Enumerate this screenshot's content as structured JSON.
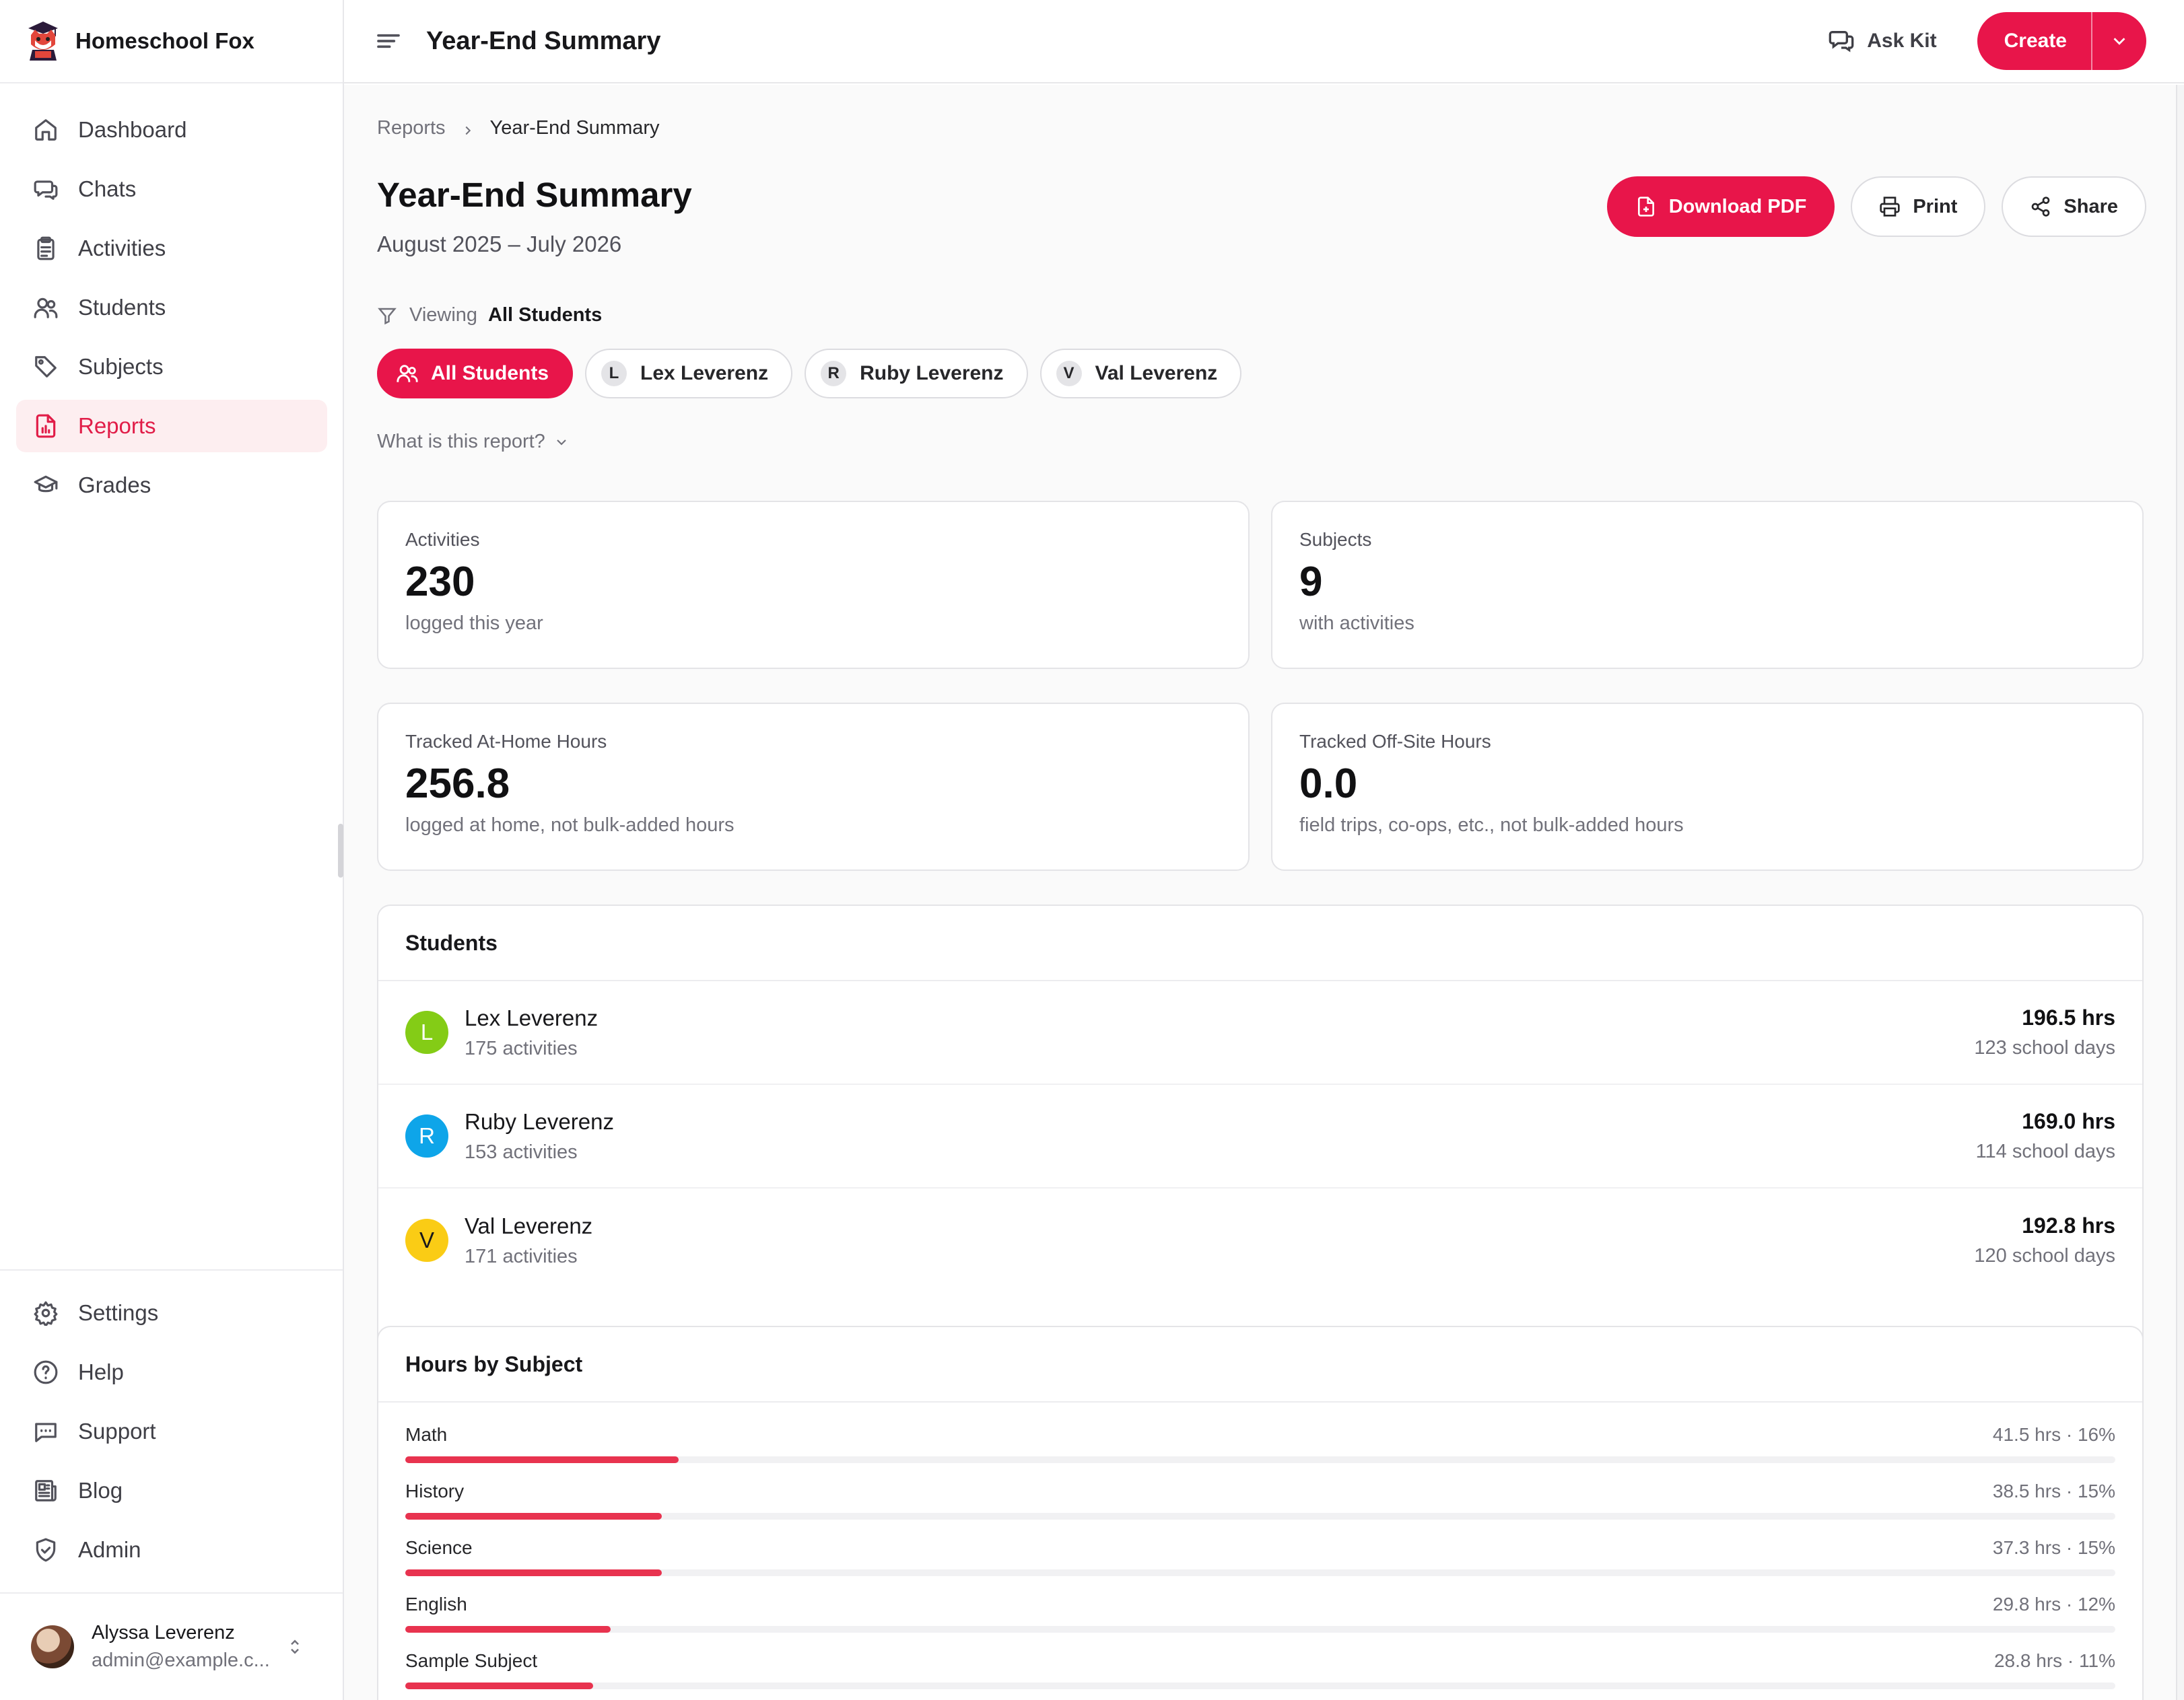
{
  "brand": {
    "name": "Homeschool Fox"
  },
  "sidebar": {
    "items": [
      {
        "label": "Dashboard",
        "icon": "home-icon"
      },
      {
        "label": "Chats",
        "icon": "chat-icon"
      },
      {
        "label": "Activities",
        "icon": "clipboard-icon"
      },
      {
        "label": "Students",
        "icon": "users-icon"
      },
      {
        "label": "Subjects",
        "icon": "tag-icon"
      },
      {
        "label": "Reports",
        "icon": "report-icon",
        "active": true
      },
      {
        "label": "Grades",
        "icon": "graduation-cap-icon"
      }
    ],
    "bottom_items": [
      {
        "label": "Settings",
        "icon": "gear-icon"
      },
      {
        "label": "Help",
        "icon": "help-icon"
      },
      {
        "label": "Support",
        "icon": "message-icon"
      },
      {
        "label": "Blog",
        "icon": "newspaper-icon"
      },
      {
        "label": "Admin",
        "icon": "shield-icon"
      }
    ],
    "user": {
      "name": "Alyssa Leverenz",
      "email": "admin@example.c..."
    }
  },
  "topbar": {
    "title": "Year-End Summary",
    "ask_label": "Ask Kit",
    "create_label": "Create"
  },
  "breadcrumb": {
    "parent": "Reports",
    "current": "Year-End Summary"
  },
  "page": {
    "title": "Year-End Summary",
    "subtitle": "August 2025 – July 2026",
    "actions": {
      "download": "Download PDF",
      "print": "Print",
      "share": "Share"
    },
    "viewing_label": "Viewing",
    "viewing_value": "All Students",
    "filters": [
      {
        "label": "All Students",
        "letter": "",
        "active": true
      },
      {
        "label": "Lex Leverenz",
        "letter": "L"
      },
      {
        "label": "Ruby Leverenz",
        "letter": "R"
      },
      {
        "label": "Val Leverenz",
        "letter": "V"
      }
    ],
    "what_is": "What is this report?"
  },
  "stats": [
    {
      "label": "Activities",
      "value": "230",
      "note": "logged this year"
    },
    {
      "label": "Subjects",
      "value": "9",
      "note": "with activities"
    },
    {
      "label": "Tracked At-Home Hours",
      "value": "256.8",
      "note": "logged at home, not bulk-added hours"
    },
    {
      "label": "Tracked Off-Site Hours",
      "value": "0.0",
      "note": "field trips, co-ops, etc., not bulk-added hours"
    }
  ],
  "students": {
    "title": "Students",
    "rows": [
      {
        "letter": "L",
        "name": "Lex Leverenz",
        "activities": "175 activities",
        "hours": "196.5 hrs",
        "days": "123 school days",
        "color": "#84cc16"
      },
      {
        "letter": "R",
        "name": "Ruby Leverenz",
        "activities": "153 activities",
        "hours": "169.0 hrs",
        "days": "114 school days",
        "color": "#0ea5e9"
      },
      {
        "letter": "V",
        "name": "Val Leverenz",
        "activities": "171 activities",
        "hours": "192.8 hrs",
        "days": "120 school days",
        "color": "#facc15"
      }
    ]
  },
  "hours_by_subject": {
    "title": "Hours by Subject",
    "scale_max_percent": 100,
    "rows": [
      {
        "name": "Math",
        "value": "41.5 hrs · 16%",
        "percent": 16
      },
      {
        "name": "History",
        "value": "38.5 hrs · 15%",
        "percent": 15
      },
      {
        "name": "Science",
        "value": "37.3 hrs · 15%",
        "percent": 15
      },
      {
        "name": "English",
        "value": "29.8 hrs · 12%",
        "percent": 12
      },
      {
        "name": "Sample Subject",
        "value": "28.8 hrs · 11%",
        "percent": 11
      }
    ]
  },
  "colors": {
    "accent": "#e8154a",
    "active_bg": "#fdeef0"
  }
}
